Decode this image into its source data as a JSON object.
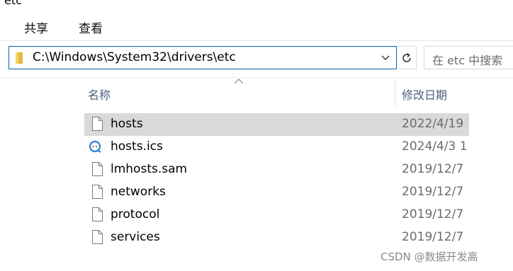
{
  "window": {
    "title_fragment": "etc"
  },
  "ribbon": {
    "tabs": [
      {
        "label": "共享"
      },
      {
        "label": "查看"
      }
    ]
  },
  "address": {
    "path": "C:\\Windows\\System32\\drivers\\etc",
    "search_placeholder": "在 etc 中搜索"
  },
  "columns": {
    "name": "名称",
    "modified": "修改日期"
  },
  "files": [
    {
      "name": "hosts",
      "date": "2022/4/19",
      "icon": "file-icon",
      "selected": true
    },
    {
      "name": "hosts.ics",
      "date": "2024/4/3 1",
      "icon": "sync-file-icon",
      "selected": false
    },
    {
      "name": "lmhosts.sam",
      "date": "2019/12/7",
      "icon": "file-icon",
      "selected": false
    },
    {
      "name": "networks",
      "date": "2019/12/7",
      "icon": "file-icon",
      "selected": false
    },
    {
      "name": "protocol",
      "date": "2019/12/7",
      "icon": "file-icon",
      "selected": false
    },
    {
      "name": "services",
      "date": "2019/12/7",
      "icon": "file-icon",
      "selected": false
    }
  ],
  "watermark": "CSDN @数据开发高",
  "colors": {
    "accent": "#0063b1",
    "selection": "#d9d9d9",
    "folder": "#e8b93c"
  }
}
